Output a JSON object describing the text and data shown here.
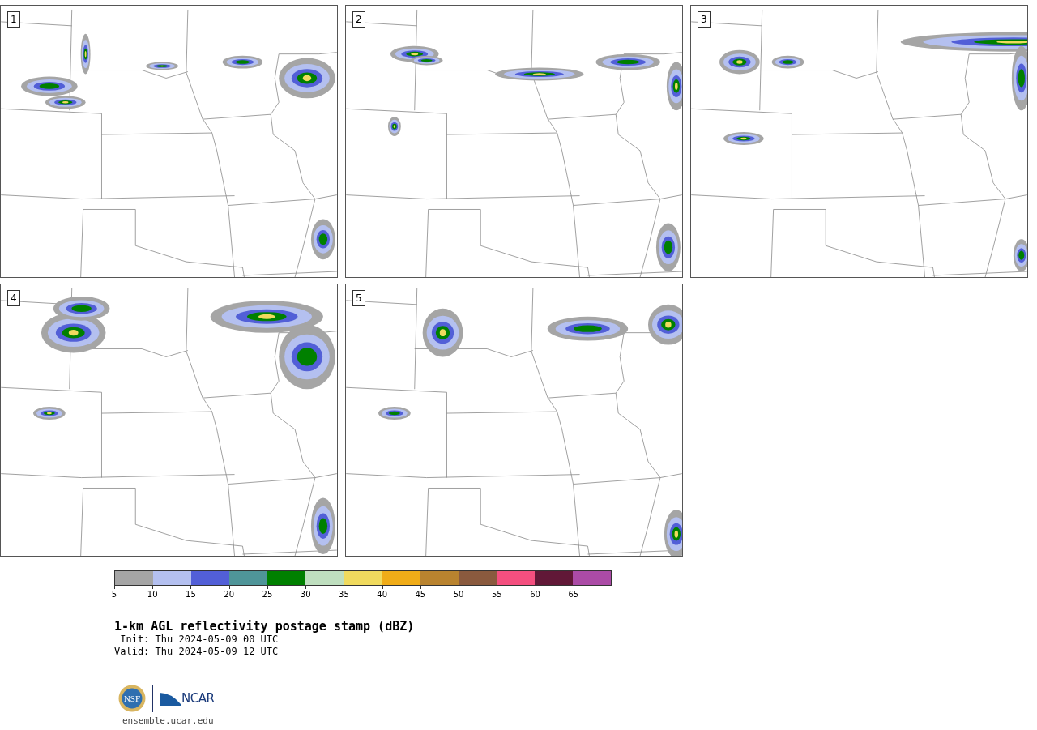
{
  "panels": [
    {
      "label": "1"
    },
    {
      "label": "2"
    },
    {
      "label": "3"
    },
    {
      "label": "4"
    },
    {
      "label": "5"
    }
  ],
  "colorbar": {
    "segments": [
      {
        "color": "#a5a5a5"
      },
      {
        "color": "#b4c0f0"
      },
      {
        "color": "#525fd7"
      },
      {
        "color": "#4f9599"
      },
      {
        "color": "#008000"
      },
      {
        "color": "#bfdfbf"
      },
      {
        "color": "#f0da5e"
      },
      {
        "color": "#f0ac18"
      },
      {
        "color": "#b9832f"
      },
      {
        "color": "#8a5a3e"
      },
      {
        "color": "#f44f7f"
      },
      {
        "color": "#611837"
      },
      {
        "color": "#ab4ba6"
      }
    ],
    "ticks": [
      "5",
      "10",
      "15",
      "20",
      "25",
      "30",
      "35",
      "40",
      "45",
      "50",
      "55",
      "60",
      "65"
    ]
  },
  "title": "1-km AGL reflectivity postage stamp (dBZ)",
  "init": " Init: Thu 2024-05-09 00 UTC",
  "valid": "Valid: Thu 2024-05-09 12 UTC",
  "logo": {
    "left": "NSF",
    "right": "NCAR"
  },
  "footer": "ensemble.ucar.edu"
}
